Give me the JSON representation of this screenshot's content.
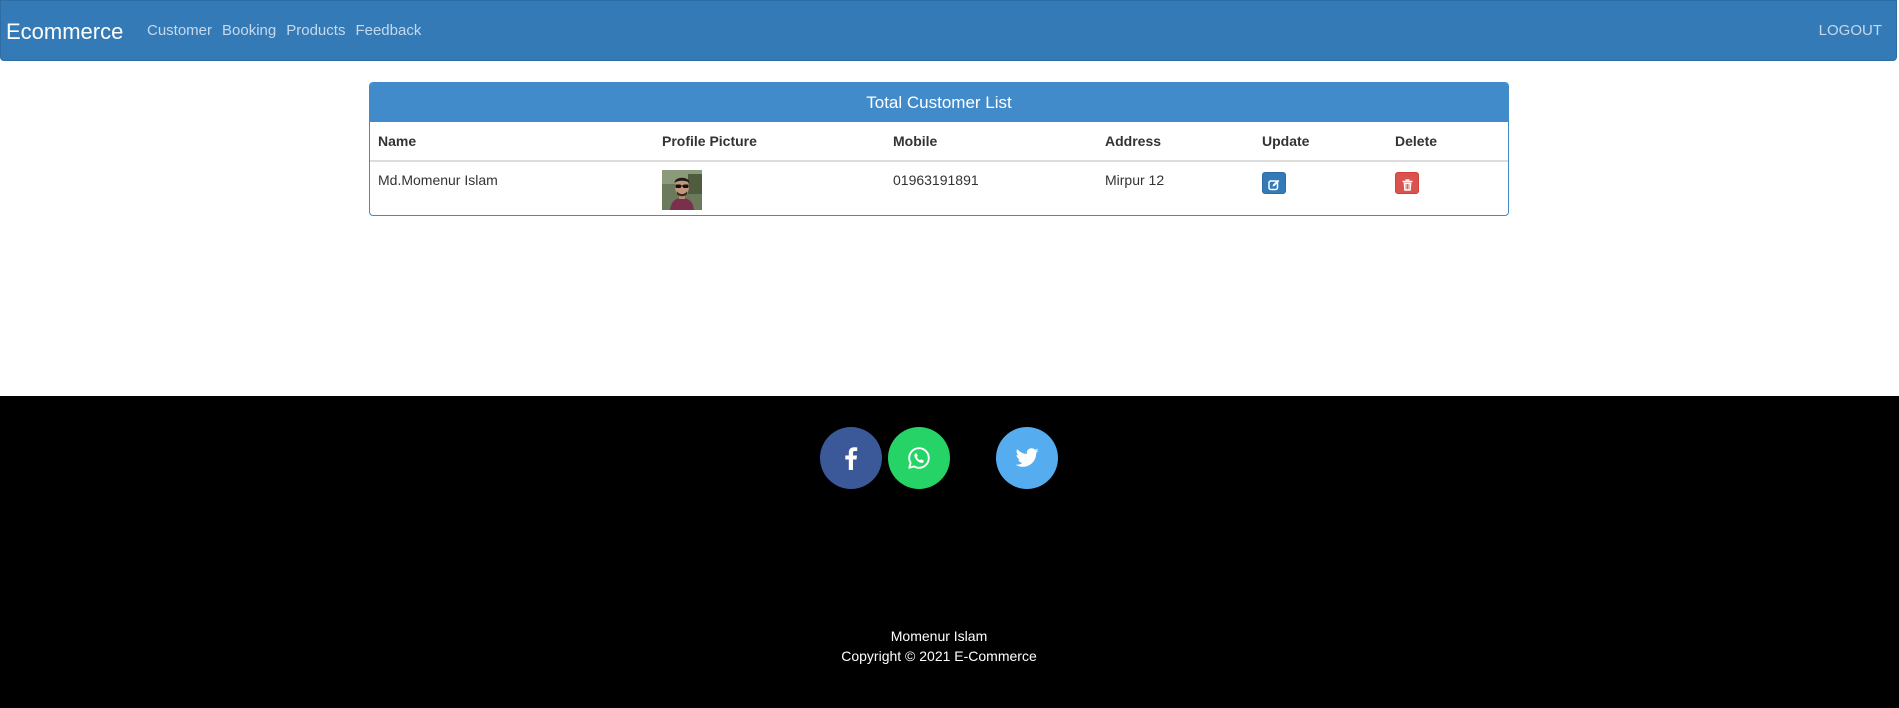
{
  "navbar": {
    "brand": "Ecommerce",
    "links": [
      "Customer",
      "Booking",
      "Products",
      "Feedback"
    ],
    "logout": "LOGOUT"
  },
  "panel": {
    "title": "Total Customer List",
    "columns": [
      "Name",
      "Profile Picture",
      "Mobile",
      "Address",
      "Update",
      "Delete"
    ],
    "rows": [
      {
        "name": "Md.Momenur Islam",
        "mobile": "01963191891",
        "address": "Mirpur 12"
      }
    ]
  },
  "footer": {
    "social": [
      "facebook-icon",
      "whatsapp-icon",
      "twitter-icon"
    ],
    "author": "Momenur Islam",
    "copyright": "Copyright © 2021 E-Commerce"
  },
  "colors": {
    "navbar": "#337ab7",
    "panel_heading": "#428bca",
    "update_button": "#337ab7",
    "delete_button": "#d9534f",
    "facebook": "#3b5998",
    "whatsapp": "#25d366",
    "twitter": "#55acee"
  }
}
